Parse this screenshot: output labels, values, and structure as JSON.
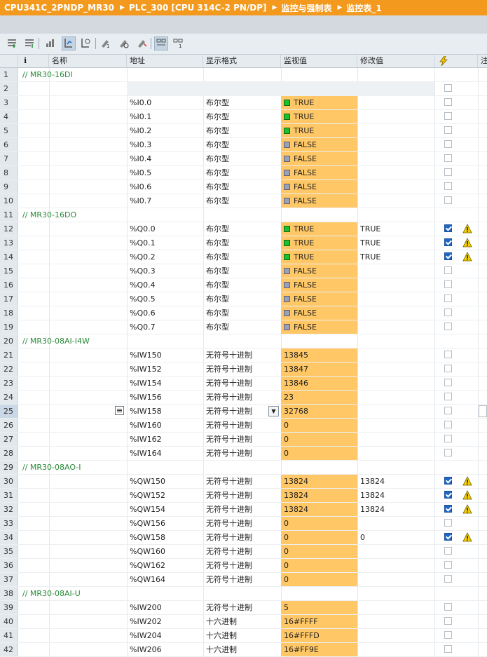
{
  "titlebar": {
    "crumbs": [
      "CPU341C_2PNDP_MR30",
      "PLC_300 [CPU 314C-2 PN/DP]",
      "监控与强制表",
      "监控表_1"
    ],
    "separator": "▶"
  },
  "toolbar": {
    "buttons": [
      {
        "name": "insert-row-icon"
      },
      {
        "name": "add-row-icon"
      },
      {
        "name": "update-values-icon"
      },
      {
        "name": "monitor-immediately-icon",
        "active": true
      },
      {
        "name": "monitor-trigger-icon"
      },
      {
        "name": "modify-now-icon"
      },
      {
        "name": "modify-trigger-icon"
      },
      {
        "name": "enable-peripheral-icon"
      },
      {
        "name": "show-extended-mode-icon",
        "active": true
      },
      {
        "name": "show-modify-columns-icon"
      }
    ]
  },
  "columns": {
    "info": "i",
    "name": "名称",
    "address": "地址",
    "format": "显示格式",
    "monitor": "监视值",
    "modify": "修改值",
    "trigger_icon": "lightning-icon",
    "comment": "注"
  },
  "rows": [
    {
      "n": "1",
      "group": "// MR30-16DI"
    },
    {
      "n": "2",
      "blank": true
    },
    {
      "n": "3",
      "addr": "%I0.0",
      "fmt": "布尔型",
      "mon": "TRUE",
      "ind": "on"
    },
    {
      "n": "4",
      "addr": "%I0.1",
      "fmt": "布尔型",
      "mon": "TRUE",
      "ind": "on"
    },
    {
      "n": "5",
      "addr": "%I0.2",
      "fmt": "布尔型",
      "mon": "TRUE",
      "ind": "on"
    },
    {
      "n": "6",
      "addr": "%I0.3",
      "fmt": "布尔型",
      "mon": "FALSE",
      "ind": "off"
    },
    {
      "n": "7",
      "addr": "%I0.4",
      "fmt": "布尔型",
      "mon": "FALSE",
      "ind": "off"
    },
    {
      "n": "8",
      "addr": "%I0.5",
      "fmt": "布尔型",
      "mon": "FALSE",
      "ind": "off"
    },
    {
      "n": "9",
      "addr": "%I0.6",
      "fmt": "布尔型",
      "mon": "FALSE",
      "ind": "off"
    },
    {
      "n": "10",
      "addr": "%I0.7",
      "fmt": "布尔型",
      "mon": "FALSE",
      "ind": "off"
    },
    {
      "n": "11",
      "group": "// MR30-16DO"
    },
    {
      "n": "12",
      "addr": "%Q0.0",
      "fmt": "布尔型",
      "mon": "TRUE",
      "ind": "on",
      "mod": "TRUE",
      "checked": true,
      "warn": true
    },
    {
      "n": "13",
      "addr": "%Q0.1",
      "fmt": "布尔型",
      "mon": "TRUE",
      "ind": "on",
      "mod": "TRUE",
      "checked": true,
      "warn": true
    },
    {
      "n": "14",
      "addr": "%Q0.2",
      "fmt": "布尔型",
      "mon": "TRUE",
      "ind": "on",
      "mod": "TRUE",
      "checked": true,
      "warn": true
    },
    {
      "n": "15",
      "addr": "%Q0.3",
      "fmt": "布尔型",
      "mon": "FALSE",
      "ind": "off"
    },
    {
      "n": "16",
      "addr": "%Q0.4",
      "fmt": "布尔型",
      "mon": "FALSE",
      "ind": "off"
    },
    {
      "n": "17",
      "addr": "%Q0.5",
      "fmt": "布尔型",
      "mon": "FALSE",
      "ind": "off"
    },
    {
      "n": "18",
      "addr": "%Q0.6",
      "fmt": "布尔型",
      "mon": "FALSE",
      "ind": "off"
    },
    {
      "n": "19",
      "addr": "%Q0.7",
      "fmt": "布尔型",
      "mon": "FALSE",
      "ind": "off"
    },
    {
      "n": "20",
      "group": "// MR30-08AI-I4W"
    },
    {
      "n": "21",
      "addr": "%IW150",
      "fmt": "无符号十进制",
      "mon": "13845"
    },
    {
      "n": "22",
      "addr": "%IW152",
      "fmt": "无符号十进制",
      "mon": "13847"
    },
    {
      "n": "23",
      "addr": "%IW154",
      "fmt": "无符号十进制",
      "mon": "13846"
    },
    {
      "n": "24",
      "addr": "%IW156",
      "fmt": "无符号十进制",
      "mon": "23"
    },
    {
      "n": "25",
      "addr": "%IW158",
      "fmt": "无符号十进制",
      "mon": "32768",
      "selected": true
    },
    {
      "n": "26",
      "addr": "%IW160",
      "fmt": "无符号十进制",
      "mon": "0"
    },
    {
      "n": "27",
      "addr": "%IW162",
      "fmt": "无符号十进制",
      "mon": "0"
    },
    {
      "n": "28",
      "addr": "%IW164",
      "fmt": "无符号十进制",
      "mon": "0"
    },
    {
      "n": "29",
      "group": "// MR30-08AO-I"
    },
    {
      "n": "30",
      "addr": "%QW150",
      "fmt": "无符号十进制",
      "mon": "13824",
      "mod": "13824",
      "checked": true,
      "warn": true
    },
    {
      "n": "31",
      "addr": "%QW152",
      "fmt": "无符号十进制",
      "mon": "13824",
      "mod": "13824",
      "checked": true,
      "warn": true
    },
    {
      "n": "32",
      "addr": "%QW154",
      "fmt": "无符号十进制",
      "mon": "13824",
      "mod": "13824",
      "checked": true,
      "warn": true
    },
    {
      "n": "33",
      "addr": "%QW156",
      "fmt": "无符号十进制",
      "mon": "0"
    },
    {
      "n": "34",
      "addr": "%QW158",
      "fmt": "无符号十进制",
      "mon": "0",
      "mod": "0",
      "checked": true,
      "warn": true
    },
    {
      "n": "35",
      "addr": "%QW160",
      "fmt": "无符号十进制",
      "mon": "0"
    },
    {
      "n": "36",
      "addr": "%QW162",
      "fmt": "无符号十进制",
      "mon": "0"
    },
    {
      "n": "37",
      "addr": "%QW164",
      "fmt": "无符号十进制",
      "mon": "0"
    },
    {
      "n": "38",
      "group": "// MR30-08AI-U"
    },
    {
      "n": "39",
      "addr": "%IW200",
      "fmt": "无符号十进制",
      "mon": "5"
    },
    {
      "n": "40",
      "addr": "%IW202",
      "fmt": "十六进制",
      "mon": "16#FFFF"
    },
    {
      "n": "41",
      "addr": "%IW204",
      "fmt": "十六进制",
      "mon": "16#FFFD"
    },
    {
      "n": "42",
      "addr": "%IW206",
      "fmt": "十六进制",
      "mon": "16#FF9E"
    }
  ],
  "colors": {
    "title_bg": "#f39a1e",
    "monitor_bg": "#ffc766",
    "indicator_true": "#1bbf30",
    "indicator_false": "#9aa0b8",
    "group_comment": "#2a8a3a",
    "checkbox_checked": "#1f66c7",
    "warning": "#f5d200"
  }
}
